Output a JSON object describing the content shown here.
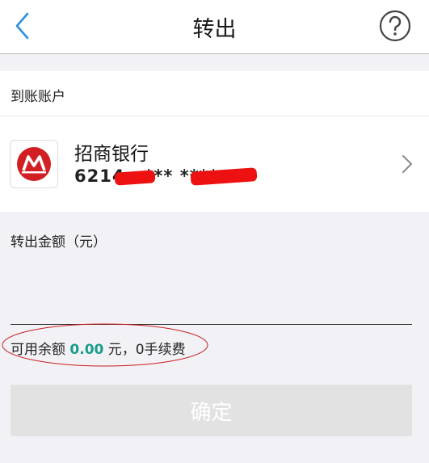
{
  "navbar": {
    "title": "转出",
    "back_icon": "chevron-left-icon",
    "help_icon": "question-circle-icon",
    "accent_color": "#2b8fe0"
  },
  "destination": {
    "section_label": "到账账户",
    "bank_name": "招商银行",
    "account_number_visible": "6214",
    "account_number_middle": "*** ****",
    "logo_icon": "china-merchants-bank-logo",
    "logo_color": "#d21f24"
  },
  "amount": {
    "label": "转出金额（元）",
    "input_value": ""
  },
  "balance": {
    "prefix": "可用余额 ",
    "value": "0.00",
    "suffix": " 元，0手续费",
    "value_color": "#1a9c8c"
  },
  "confirm": {
    "label": "确定"
  }
}
